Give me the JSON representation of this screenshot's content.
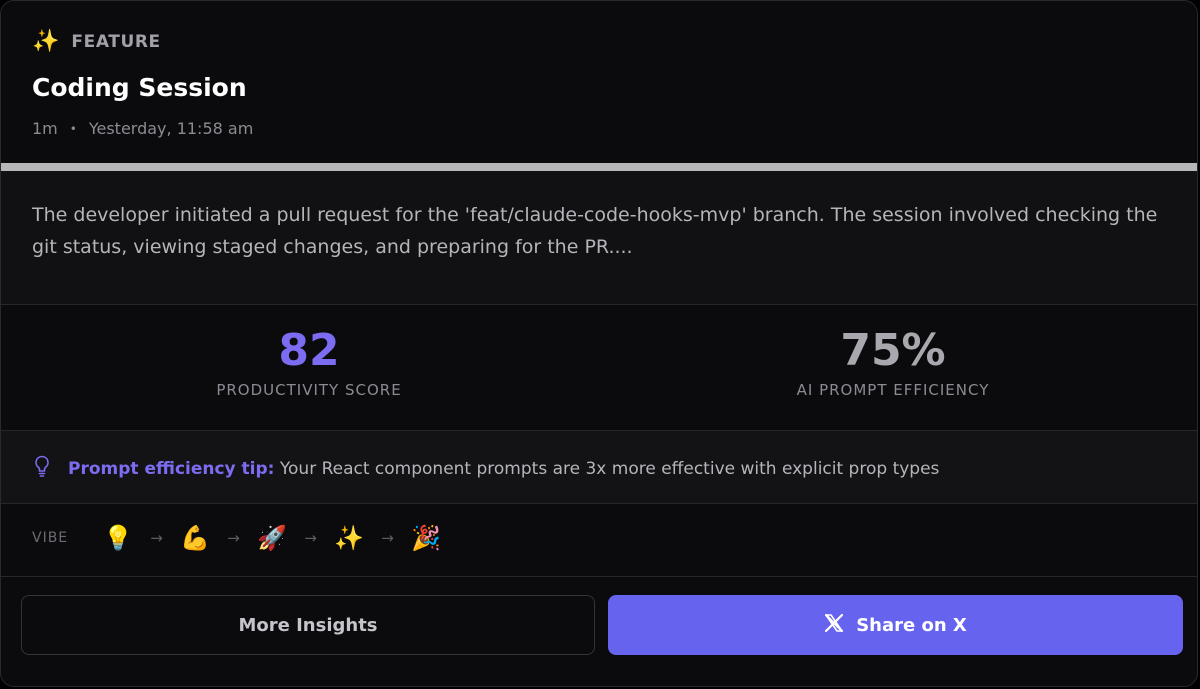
{
  "header": {
    "tag_icon": "✨",
    "tag_label": "FEATURE",
    "title": "Coding Session",
    "duration": "1m",
    "separator": "•",
    "timestamp": "Yesterday, 11:58 am"
  },
  "progress": {
    "fraction": 1.0,
    "color": "#b6b6bb"
  },
  "summary": {
    "text": "The developer initiated a pull request for the 'feat/claude-code-hooks-mvp' branch. The session involved checking the git status, viewing staged changes, and preparing for the PR...."
  },
  "stats": {
    "productivity": {
      "value": "82",
      "label": "PRODUCTIVITY SCORE",
      "color": "#7c6cf2"
    },
    "efficiency": {
      "value": "75%",
      "label": "AI PROMPT EFFICIENCY",
      "color": "#a8a8ae"
    }
  },
  "tip": {
    "icon": "lightbulb-icon",
    "title": "Prompt efficiency tip:",
    "text": "Your React component prompts are 3x more effective with explicit prop types"
  },
  "vibe": {
    "label": "VIBE",
    "arrow": "→",
    "emojis": [
      "💡",
      "💪",
      "🚀",
      "✨",
      "🎉"
    ]
  },
  "actions": {
    "more_insights": "More Insights",
    "share": "Share on X",
    "accent": "#6663ee"
  }
}
